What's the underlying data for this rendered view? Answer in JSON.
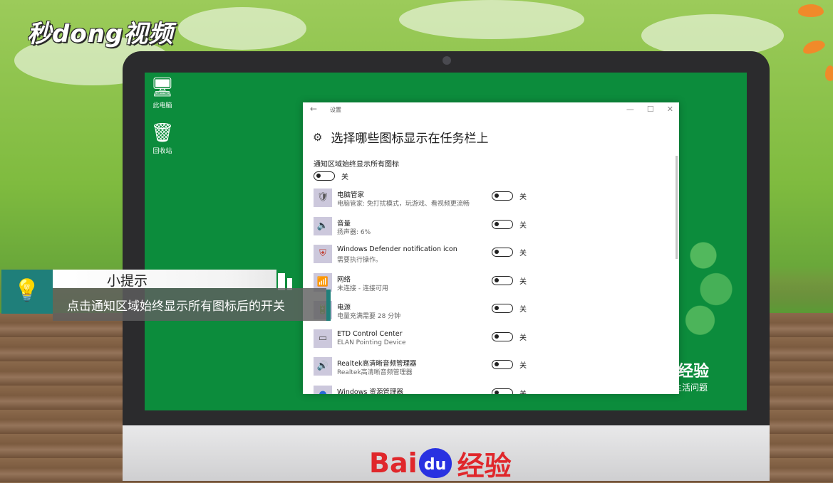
{
  "brand": {
    "logo_text": "秒dong视频"
  },
  "desktop": {
    "icons": [
      {
        "label": "此电脑",
        "icon": "computer-icon"
      },
      {
        "label": "回收站",
        "icon": "recycle-bin-icon"
      }
    ],
    "bg_watermark": {
      "title": "经验",
      "subtitle": "生活问题"
    }
  },
  "window": {
    "title": "设置",
    "heading": "选择哪些图标显示在任务栏上",
    "master_setting": {
      "label": "通知区域始终显示所有图标",
      "state": "关"
    },
    "items": [
      {
        "icon": "shield-check-icon",
        "glyph": "🛡",
        "name": "电脑管家",
        "desc": "电脑管家: 免打扰模式，玩游戏、看视频更流畅",
        "state": "关"
      },
      {
        "icon": "speaker-icon",
        "glyph": "🔈",
        "name": "音量",
        "desc": "扬声器: 6%",
        "state": "关"
      },
      {
        "icon": "defender-shield-icon",
        "glyph": "⛨",
        "name": "Windows Defender notification icon",
        "desc": "需要执行操作。",
        "state": "关"
      },
      {
        "icon": "network-icon",
        "glyph": "📶",
        "name": "网络",
        "desc": "未连接 - 连接可用",
        "state": "关"
      },
      {
        "icon": "battery-icon",
        "glyph": "🔋",
        "name": "电源",
        "desc": "电量充满需要 28 分钟",
        "state": "关"
      },
      {
        "icon": "touchpad-icon",
        "glyph": "▭",
        "name": "ETD Control Center",
        "desc": "ELAN Pointing Device",
        "state": "关"
      },
      {
        "icon": "audio-manager-icon",
        "glyph": "🔊",
        "name": "Realtek高清晰音频管理器",
        "desc": "Realtek高清晰音频管理器",
        "state": "关"
      },
      {
        "icon": "file-explorer-icon",
        "glyph": "●",
        "name": "Windows 资源管理器",
        "desc": "",
        "state": "关"
      }
    ]
  },
  "tip": {
    "title": "小提示",
    "text": "点击通知区域始终显示所有图标后的开关"
  },
  "monitor_brand": {
    "baidu": "Bai",
    "du": "du",
    "jingyan": "经验"
  }
}
